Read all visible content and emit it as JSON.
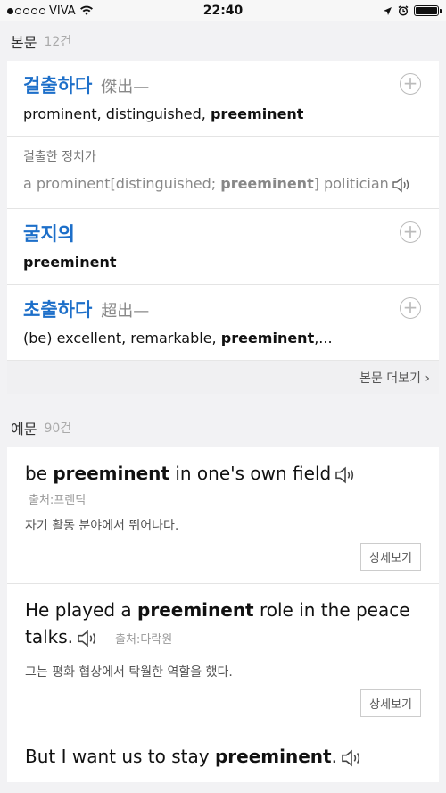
{
  "status": {
    "carrier": "VIVA",
    "time": "22:40",
    "signal_bars": 1,
    "battery_level": 1.0
  },
  "main_section": {
    "title": "본문",
    "count": "12건"
  },
  "entries": [
    {
      "word": "걸출하다",
      "hanja": "傑出—",
      "def_plain": "prominent, distinguished, ",
      "def_bold": "preeminent",
      "def_tail": ""
    },
    {
      "word": "굴지의",
      "hanja": "",
      "def_plain": "",
      "def_bold": "preeminent",
      "def_tail": ""
    },
    {
      "word": "초출하다",
      "hanja": "超出—",
      "def_plain": "(be) excellent, remarkable, ",
      "def_bold": "preeminent",
      "def_tail": ",..."
    }
  ],
  "entry_example": {
    "ko": "걸출한 정치가",
    "en_pre": "a prominent[distinguished; ",
    "en_bold": "preeminent",
    "en_post": "] politician"
  },
  "more_main": "본문 더보기",
  "examples_section": {
    "title": "예문",
    "count": "90건"
  },
  "examples": [
    {
      "pre": "be ",
      "bold": "preeminent",
      "post": " in one's own field",
      "source": "출처:프렌딕",
      "trans": "자기 활동 분야에서 뛰어나다.",
      "detail": "상세보기"
    },
    {
      "pre": "He played a ",
      "bold": "preeminent",
      "post": " role in the peace talks.",
      "source": "출처:다락원",
      "trans": "그는 평화 협상에서 탁월한 역할을 했다.",
      "detail": "상세보기"
    },
    {
      "pre": "But I want us to stay ",
      "bold": "preeminent",
      "post": "."
    }
  ],
  "icons": {
    "plus": "+",
    "accent": "#1d6fc9"
  }
}
